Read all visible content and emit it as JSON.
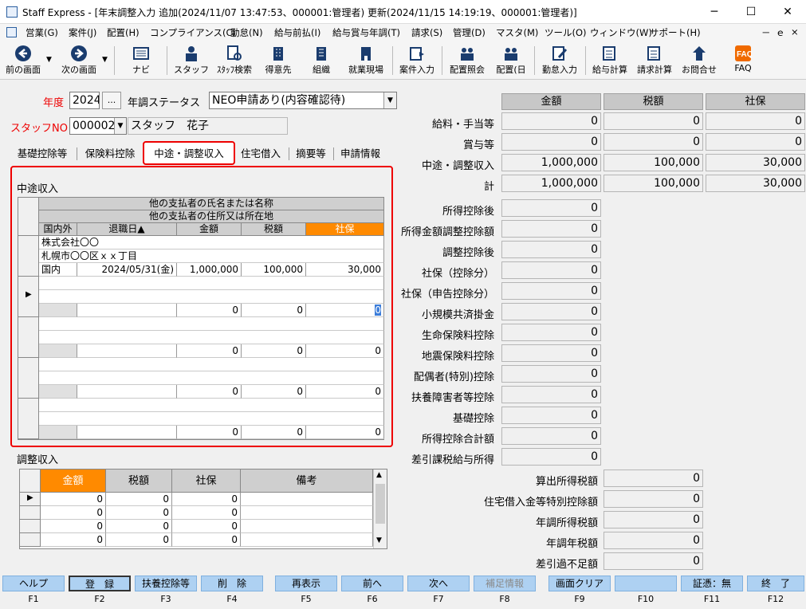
{
  "window": {
    "title": "Staff Express - [年末調整入力 追加(2024/11/07 13:47:53、000001:管理者) 更新(2024/11/15 14:19:19、000001:管理者)]",
    "minimize": "─",
    "maximize": "☐",
    "close": "✕"
  },
  "menu": [
    "営業(G)",
    "案件(J)",
    "配置(H)",
    "コンプライアンス(C)",
    "勤怠(N)",
    "給与前払(I)",
    "給与賞与年調(T)",
    "請求(S)",
    "管理(D)",
    "マスタ(M)",
    "ツール(O)",
    "ウィンドウ(W)",
    "サポート(H)"
  ],
  "menu_right": [
    "－",
    "ｅ",
    "×"
  ],
  "toolbar": [
    "前の画面",
    "次の画面",
    "ナビ",
    "スタッフ",
    "ｽﾀｯﾌ検索",
    "得意先",
    "組織",
    "就業現場",
    "案件入力",
    "配置照会",
    "配置(日",
    "勤怠入力",
    "給与計算",
    "請求計算",
    "お問合せ",
    "FAQ"
  ],
  "form": {
    "year_label": "年度",
    "year_value": "2024",
    "year_btn": "...",
    "status_label": "年調ステータス",
    "status_value": "NEO申請あり(内容確認待)",
    "staff_label": "スタッフNO",
    "staff_no": "000002",
    "staff_name": "スタッフ　花子"
  },
  "tabs": [
    "基礎控除等",
    "保険料控除",
    "中途・調整収入",
    "住宅借入",
    "摘要等",
    "申請情報"
  ],
  "chuto": {
    "title": "中途収入",
    "head1": "他の支払者の氏名または名称",
    "head2": "他の支払者の住所又は所在地",
    "cols": [
      "国内外",
      "退職日▲",
      "金額",
      "税額",
      "社保"
    ],
    "rec1": {
      "name": "株式会社〇〇",
      "addr": "札幌市〇〇区ｘｘ丁目",
      "kokunai": "国内",
      "date": "2024/05/31(金)",
      "amount": "1,000,000",
      "tax": "100,000",
      "shaho": "30,000"
    },
    "zero": "0"
  },
  "chosei": {
    "title": "調整収入",
    "cols": [
      "金額",
      "税額",
      "社保",
      "備考"
    ],
    "zero": "0"
  },
  "summary": {
    "heads": [
      "金額",
      "税額",
      "社保"
    ],
    "rows": [
      {
        "label": "給料・手当等",
        "v": [
          "0",
          "0",
          "0"
        ]
      },
      {
        "label": "賞与等",
        "v": [
          "0",
          "0",
          "0"
        ]
      },
      {
        "label": "中途・調整収入",
        "v": [
          "1,000,000",
          "100,000",
          "30,000"
        ]
      },
      {
        "label": "計",
        "v": [
          "1,000,000",
          "100,000",
          "30,000"
        ]
      }
    ],
    "single": [
      {
        "label": "所得控除後",
        "v": "0"
      },
      {
        "label": "所得金額調整控除額",
        "v": "0"
      },
      {
        "label": "調整控除後",
        "v": "0"
      },
      {
        "label": "社保（控除分）",
        "v": "0"
      },
      {
        "label": "社保（申告控除分）",
        "v": "0"
      },
      {
        "label": "小規模共済掛金",
        "v": "0"
      },
      {
        "label": "生命保険料控除",
        "v": "0"
      },
      {
        "label": "地震保険料控除",
        "v": "0"
      },
      {
        "label": "配偶者(特別)控除",
        "v": "0"
      },
      {
        "label": "扶養障害者等控除",
        "v": "0"
      },
      {
        "label": "基礎控除",
        "v": "0"
      },
      {
        "label": "所得控除合計額",
        "v": "0"
      },
      {
        "label": "差引課税給与所得",
        "v": "0"
      }
    ],
    "tax": [
      {
        "label": "算出所得税額",
        "v": "0"
      },
      {
        "label": "住宅借入金等特別控除額",
        "v": "0"
      },
      {
        "label": "年調所得税額",
        "v": "0"
      },
      {
        "label": "年調年税額",
        "v": "0"
      },
      {
        "label": "差引過不足額",
        "v": "0"
      }
    ]
  },
  "fkeys": [
    {
      "label": "ヘルプ",
      "key": "F1"
    },
    {
      "label": "登　録",
      "key": "F2"
    },
    {
      "label": "扶養控除等",
      "key": "F3"
    },
    {
      "label": "削　除",
      "key": "F4"
    },
    {
      "label": "再表示",
      "key": "F5"
    },
    {
      "label": "前へ",
      "key": "F6"
    },
    {
      "label": "次へ",
      "key": "F7"
    },
    {
      "label": "補足情報",
      "key": "F8"
    },
    {
      "label": "画面クリア",
      "key": "F9"
    },
    {
      "label": "",
      "key": "F10"
    },
    {
      "label": "証憑：無",
      "key": "F11"
    },
    {
      "label": "終　了",
      "key": "F12"
    }
  ],
  "colors": {
    "accent_red": "#e00000",
    "orange": "#ff8a00",
    "fkey_blue": "#aed1f2"
  }
}
